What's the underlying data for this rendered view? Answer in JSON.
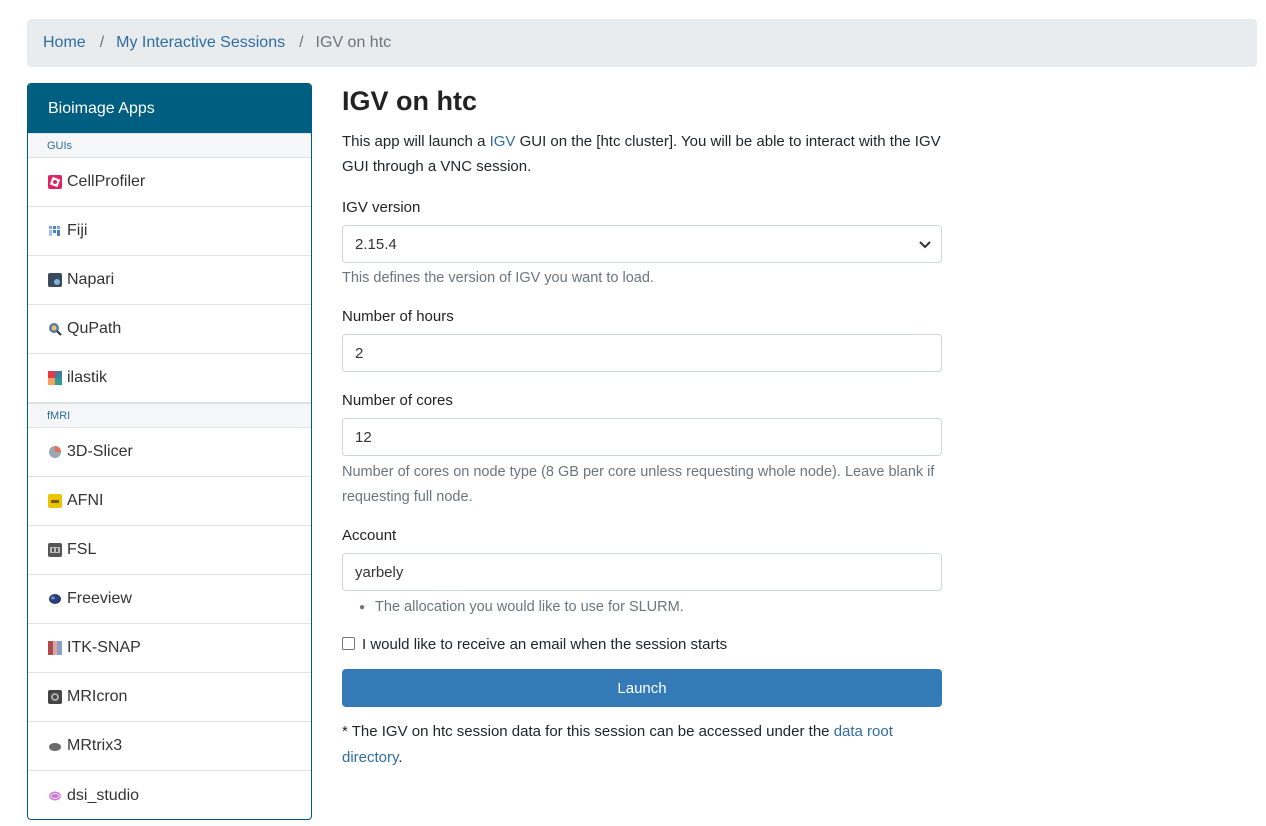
{
  "breadcrumb": {
    "items": [
      "Home",
      "My Interactive Sessions"
    ],
    "current": "IGV on htc",
    "separator": "/"
  },
  "sidebar": {
    "title": "Bioimage Apps",
    "sections": [
      {
        "label": "GUIs",
        "items": [
          {
            "label": "CellProfiler",
            "icon": "cellprofiler-icon"
          },
          {
            "label": "Fiji",
            "icon": "fiji-icon"
          },
          {
            "label": "Napari",
            "icon": "napari-icon"
          },
          {
            "label": "QuPath",
            "icon": "qupath-icon"
          },
          {
            "label": "ilastik",
            "icon": "ilastik-icon"
          }
        ]
      },
      {
        "label": "fMRI",
        "items": [
          {
            "label": "3D-Slicer",
            "icon": "3d-slicer-icon"
          },
          {
            "label": "AFNI",
            "icon": "afni-icon"
          },
          {
            "label": "FSL",
            "icon": "fsl-icon"
          },
          {
            "label": "Freeview",
            "icon": "freeview-icon"
          },
          {
            "label": "ITK-SNAP",
            "icon": "itk-snap-icon"
          },
          {
            "label": "MRIcron",
            "icon": "mricron-icon"
          },
          {
            "label": "MRtrix3",
            "icon": "mrtrix3-icon"
          },
          {
            "label": "dsi_studio",
            "icon": "dsi-studio-icon"
          }
        ]
      }
    ]
  },
  "main": {
    "title": "IGV on htc",
    "intro_before": "This app will launch a ",
    "intro_link": "IGV",
    "intro_after": " GUI on the [htc cluster]. You will be able to interact with the IGV GUI through a VNC session.",
    "igv_version": {
      "label": "IGV version",
      "value": "2.15.4",
      "help": "This defines the version of IGV you want to load."
    },
    "hours": {
      "label": "Number of hours",
      "value": "2"
    },
    "cores": {
      "label": "Number of cores",
      "value": "12",
      "help": "Number of cores on node type (8 GB per core unless requesting whole node). Leave blank if requesting full node."
    },
    "account": {
      "label": "Account",
      "value": "yarbely",
      "help": "The allocation you would like to use for SLURM."
    },
    "email_checkbox_label": "I would like to receive an email when the session starts",
    "launch_label": "Launch",
    "footer_before": "* The IGV on htc session data for this session can be accessed under the ",
    "footer_link": "data root directory",
    "footer_after": "."
  },
  "colors": {
    "sidebar_header": "#005f80",
    "launch_button": "#337ab7",
    "link": "#2f6da1",
    "breadcrumb_bg": "#e9ecef"
  }
}
